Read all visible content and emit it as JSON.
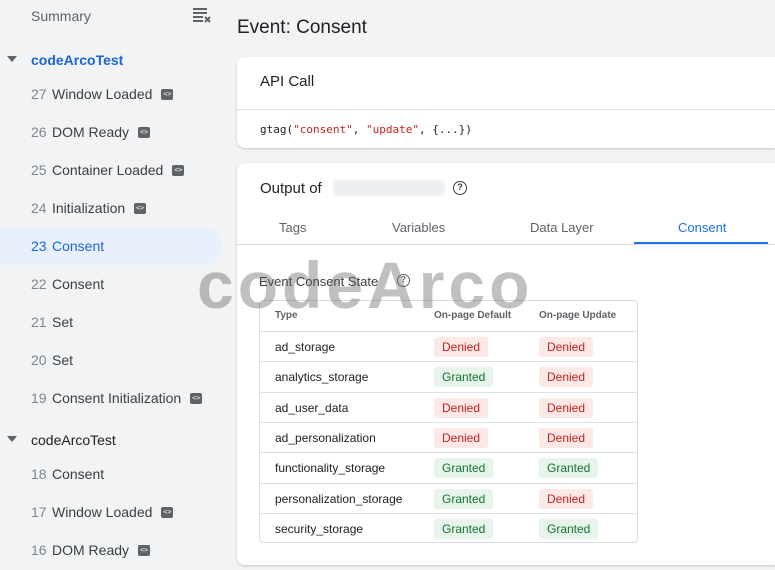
{
  "sidebar": {
    "summary_label": "Summary",
    "containers": [
      {
        "name": "codeArcoTest",
        "items": [
          {
            "num": "27",
            "label": "Window Loaded",
            "tag": true
          },
          {
            "num": "26",
            "label": "DOM Ready",
            "tag": true
          },
          {
            "num": "25",
            "label": "Container Loaded",
            "tag": true
          },
          {
            "num": "24",
            "label": "Initialization",
            "tag": true
          },
          {
            "num": "23",
            "label": "Consent",
            "tag": false,
            "active": true
          },
          {
            "num": "22",
            "label": "Consent",
            "tag": false
          },
          {
            "num": "21",
            "label": "Set",
            "tag": false
          },
          {
            "num": "20",
            "label": "Set",
            "tag": false
          },
          {
            "num": "19",
            "label": "Consent Initialization",
            "tag": true
          }
        ]
      },
      {
        "name": "codeArcoTest",
        "items": [
          {
            "num": "18",
            "label": "Consent",
            "tag": false
          },
          {
            "num": "17",
            "label": "Window Loaded",
            "tag": true
          },
          {
            "num": "16",
            "label": "DOM Ready",
            "tag": true
          }
        ]
      }
    ]
  },
  "main": {
    "title": "Event: Consent",
    "api_call": {
      "heading": "API Call",
      "code_fn": "gtag(",
      "code_arg1": "\"consent\"",
      "code_sep": ", ",
      "code_arg2": "\"update\"",
      "code_rest": ", {...})"
    },
    "output": {
      "heading": "Output of",
      "tabs": [
        "Tags",
        "Variables",
        "Data Layer",
        "Consent"
      ],
      "active_tab": "Consent",
      "section_title": "Event Consent State",
      "columns": [
        "Type",
        "On-page Default",
        "On-page Update"
      ],
      "rows": [
        {
          "type": "ad_storage",
          "default": "Denied",
          "update": "Denied"
        },
        {
          "type": "analytics_storage",
          "default": "Granted",
          "update": "Denied"
        },
        {
          "type": "ad_user_data",
          "default": "Denied",
          "update": "Denied"
        },
        {
          "type": "ad_personalization",
          "default": "Denied",
          "update": "Denied"
        },
        {
          "type": "functionality_storage",
          "default": "Granted",
          "update": "Granted"
        },
        {
          "type": "personalization_storage",
          "default": "Granted",
          "update": "Denied"
        },
        {
          "type": "security_storage",
          "default": "Granted",
          "update": "Granted"
        }
      ]
    }
  },
  "watermark": "codeArco",
  "colors": {
    "accent": "#1a73e8",
    "denied_text": "#c5221f",
    "denied_bg": "#fce8e6",
    "granted_text": "#137333",
    "granted_bg": "#e6f4ea"
  }
}
